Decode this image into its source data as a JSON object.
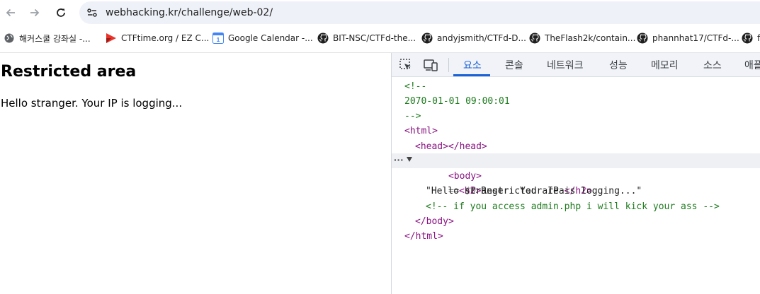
{
  "browser": {
    "url": "webhacking.kr/challenge/web-02/",
    "bookmarks": [
      {
        "label": "해커스쿨 강좌실 -...",
        "icon": "globe-icon"
      },
      {
        "label": "CTFtime.org / EZ C...",
        "icon": "ctftime-flag-icon"
      },
      {
        "label": "Google Calendar -...",
        "icon": "google-calendar-icon"
      },
      {
        "label": "BIT-NSC/CTFd-the...",
        "icon": "github-icon"
      },
      {
        "label": "andyjsmith/CTFd-D...",
        "icon": "github-icon"
      },
      {
        "label": "TheFlash2k/contain...",
        "icon": "github-icon"
      },
      {
        "label": "phannhat17/CTFd-...",
        "icon": "github-icon"
      },
      {
        "label": "f",
        "icon": "github-icon"
      }
    ]
  },
  "page": {
    "heading": "Restricted area",
    "paragraph": "Hello stranger. Your IP is logging..."
  },
  "devtools": {
    "tabs": [
      "요소",
      "콘솔",
      "네트워크",
      "성능",
      "메모리",
      "소스",
      "애플"
    ],
    "active_tab": "요소",
    "source": {
      "comment_open": "<!--",
      "comment_date": "2070-01-01 09:00:01",
      "comment_close": "-->",
      "html_open": "<html>",
      "head": "<head></head>",
      "body_open": "<body>",
      "selected_marker": "== $0",
      "h2_open": "<h2>",
      "h2_text": "Restricted area",
      "h2_close": "</h2>",
      "text_node": "\"Hello stranger. Your IP is logging...\"",
      "hidden_comment": "<!-- if you access admin.php i will kick your ass -->",
      "body_close": "</body>",
      "html_close": "</html>",
      "row_menu": "···"
    }
  },
  "colors": {
    "accent": "#1a62d6",
    "tag": "#881280",
    "comment": "#1e7a1e"
  }
}
